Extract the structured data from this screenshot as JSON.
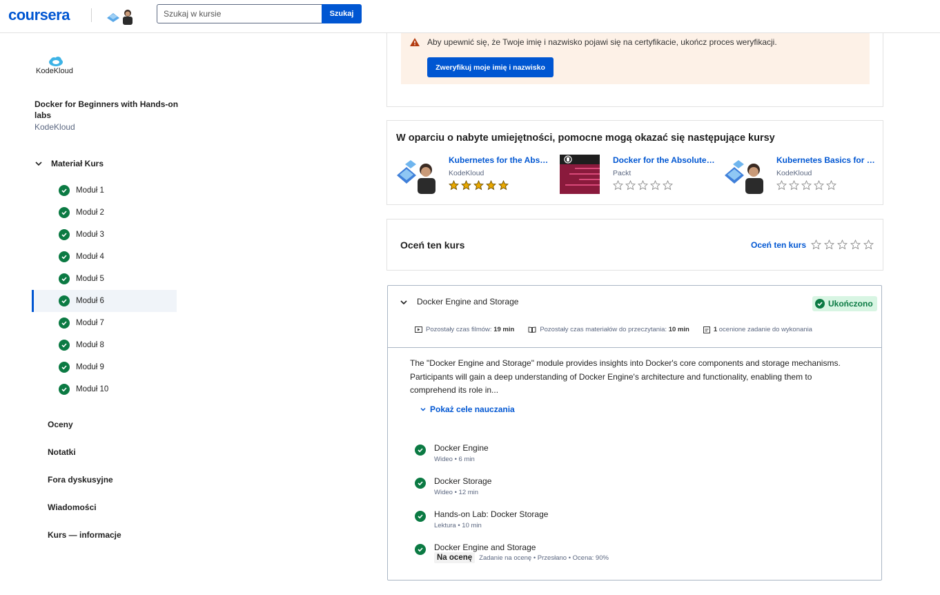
{
  "header": {
    "logo": "coursera",
    "search_placeholder": "Szukaj w kursie",
    "search_button": "Szukaj"
  },
  "sidebar": {
    "partner_logo_text": "KodeKloud",
    "course_title": "Docker for Beginners with Hands-on labs",
    "course_org": "KodeKloud",
    "materials_label": "Materiał Kurs",
    "modules": [
      {
        "label": "Moduł 1",
        "active": false
      },
      {
        "label": "Moduł 2",
        "active": false
      },
      {
        "label": "Moduł 3",
        "active": false
      },
      {
        "label": "Moduł 4",
        "active": false
      },
      {
        "label": "Moduł 5",
        "active": false
      },
      {
        "label": "Moduł 6",
        "active": true
      },
      {
        "label": "Moduł 7",
        "active": false
      },
      {
        "label": "Moduł 8",
        "active": false
      },
      {
        "label": "Moduł 9",
        "active": false
      },
      {
        "label": "Moduł 10",
        "active": false
      }
    ],
    "nav": [
      "Oceny",
      "Notatki",
      "Fora dyskusyjne",
      "Wiadomości",
      "Kurs — informacje"
    ]
  },
  "verify": {
    "text": "Aby upewnić się, że Twoje imię i nazwisko pojawi się na certyfikacie, ukończ proces weryfikacji.",
    "button": "Zweryfikuj moje imię i nazwisko"
  },
  "recommendations": {
    "title": "W oparciu o nabyte umiejętności, pomocne mogą okazać się następujące kursy",
    "items": [
      {
        "name": "Kubernetes for the Absolute Beginners",
        "org": "KodeKloud",
        "rating": 5
      },
      {
        "name": "Docker for the Absolute Beginners",
        "org": "Packt",
        "rating": 0
      },
      {
        "name": "Kubernetes Basics for DevOps",
        "org": "KodeKloud",
        "rating": 0
      }
    ]
  },
  "rate": {
    "title": "Oceń ten kurs",
    "link": "Oceń ten kurs",
    "rating": 0
  },
  "module": {
    "title": "Docker Engine and Storage",
    "status": "Ukończono",
    "stats": {
      "video_label": "Pozostały czas filmów:",
      "video_value": "19 min",
      "reading_label": "Pozostały czas materiałów do przeczytania:",
      "reading_value": "10 min",
      "graded_value": "1",
      "graded_label": "ocenione zadanie do wykonania"
    },
    "description": "The \"Docker Engine and Storage\" module provides insights into Docker's core components and storage mechanisms. Participants will gain a deep understanding of Docker Engine's architecture and functionality, enabling them to comprehend its role in...",
    "show_goals": "Pokaż cele nauczania",
    "items": [
      {
        "title": "Docker Engine",
        "meta": "Wideo • 6 min",
        "tag": ""
      },
      {
        "title": "Docker Storage",
        "meta": "Wideo • 12 min",
        "tag": ""
      },
      {
        "title": "Hands-on Lab: Docker Storage",
        "meta": "Lektura • 10 min",
        "tag": ""
      },
      {
        "title": "Docker Engine and Storage",
        "meta": "Zadanie na ocenę • Przesłano • Ocena: 90%",
        "tag": "Na ocenę"
      }
    ]
  },
  "colors": {
    "brand": "#0056d2",
    "success": "#0b7a43",
    "warning_bg": "#fdf1e7",
    "warning_icon": "#b33b10",
    "star_gold": "#e9a800"
  }
}
